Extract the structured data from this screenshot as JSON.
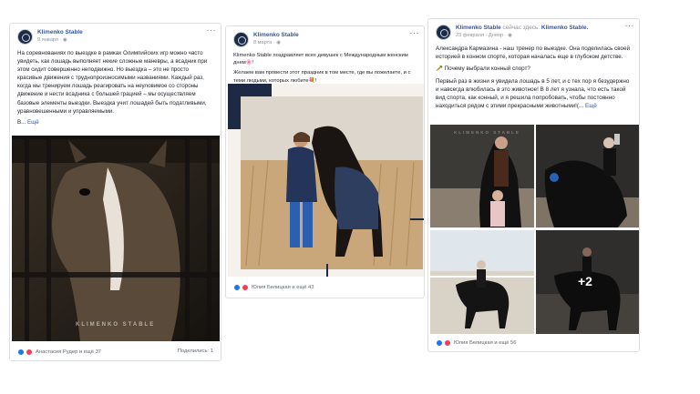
{
  "posts": [
    {
      "author": "Klimenko Stable",
      "date": "9 января",
      "privacy_icon": "globe-icon",
      "text": "На соревнованиях по выездке в рамках Олимпийских игр можно часто увидеть, как лошадь выполняет некие сложные маневры, а всадник при этом сидит совершенно неподвижно. Но выездка – это не просто красивые движения с труднопроизносимыми названиями. Каждый раз, когда мы тренируем лошадь реагировать на неуловимое со стороны движение и нести всадника с большей грацией – мы осуществляем базовые элементы выездки. Выездка учит лошадей быть податливыми, уравновешенными и управляемыми.",
      "ellipsis": "В...",
      "more_label": "Ещё",
      "watermark": "KLIMENKO STABLE",
      "reactions": "Анастасия Рудер и ещё 37",
      "shares": "Поделились: 1"
    },
    {
      "author": "Klimenko Stable",
      "date": "8 марта",
      "privacy_icon": "globe-icon",
      "text": "Klimenko Stable поздравляет всех девушек с Международным женским днем🌸!",
      "text2": "Желаем вам провести этот праздник в том месте, где вы пожелаете, и с теми людьми, которых любите💐!",
      "reactions": "Юлия Белицкая и ещё 43"
    },
    {
      "author": "Klimenko Stable",
      "author_extra_prefix": "сейчас здесь:",
      "author_extra_place": "Klimenko Stable.",
      "date": "23 февраля",
      "location": "Днепр",
      "privacy_icon": "globe-icon",
      "text": "Александра Кармазина - наш тренер по выездке. Она поделилась своей историей в конном спорте, которая началась еще в глубоком детстве.",
      "question": "🥕 Почему выбрали конный спорт?",
      "text2": "Первый раз в жизни я увидела лошадь в 5 лет, и с тех пор я безудержно и навсегда влюбилась в это животное! В 8 лет я узнала, что есть такой вид спорта, как конный, и я решила попробовать, чтобы постоянно находиться рядом с этими прекрасными животными!(...",
      "more_label": "Ещё",
      "watermark": "KLIMENKO STABLE",
      "more_photos": "+2",
      "reactions": "Юлия Белицкая и ещё 56"
    }
  ],
  "colors": {
    "link": "#385898",
    "meta": "#90949c",
    "text": "#1d2129",
    "like": "#1877f2",
    "love": "#f33e58"
  }
}
